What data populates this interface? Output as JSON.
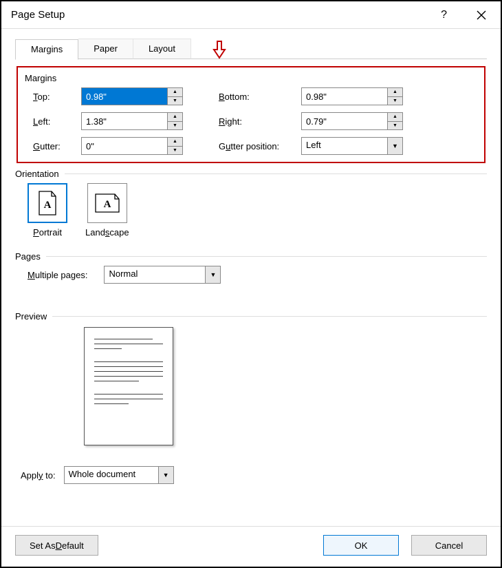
{
  "window": {
    "title": "Page Setup"
  },
  "tabs": [
    "Margins",
    "Paper",
    "Layout"
  ],
  "active_tab": 0,
  "margins": {
    "header": "Margins",
    "top_label": "Top:",
    "top_value": "0.98\"",
    "bottom_label": "Bottom:",
    "bottom_value": "0.98\"",
    "left_label": "Left:",
    "left_value": "1.38\"",
    "right_label": "Right:",
    "right_value": "0.79\"",
    "gutter_label": "Gutter:",
    "gutter_value": "0\"",
    "gutter_pos_label": "Gutter position:",
    "gutter_pos_value": "Left"
  },
  "orientation": {
    "header": "Orientation",
    "portrait_label": "Portrait",
    "landscape_label": "Landscape",
    "selected": "portrait"
  },
  "pages": {
    "header": "Pages",
    "multiple_label": "Multiple pages:",
    "multiple_value": "Normal"
  },
  "preview": {
    "header": "Preview"
  },
  "apply": {
    "label": "Apply to:",
    "value": "Whole document"
  },
  "buttons": {
    "default": "Set As Default",
    "ok": "OK",
    "cancel": "Cancel"
  }
}
